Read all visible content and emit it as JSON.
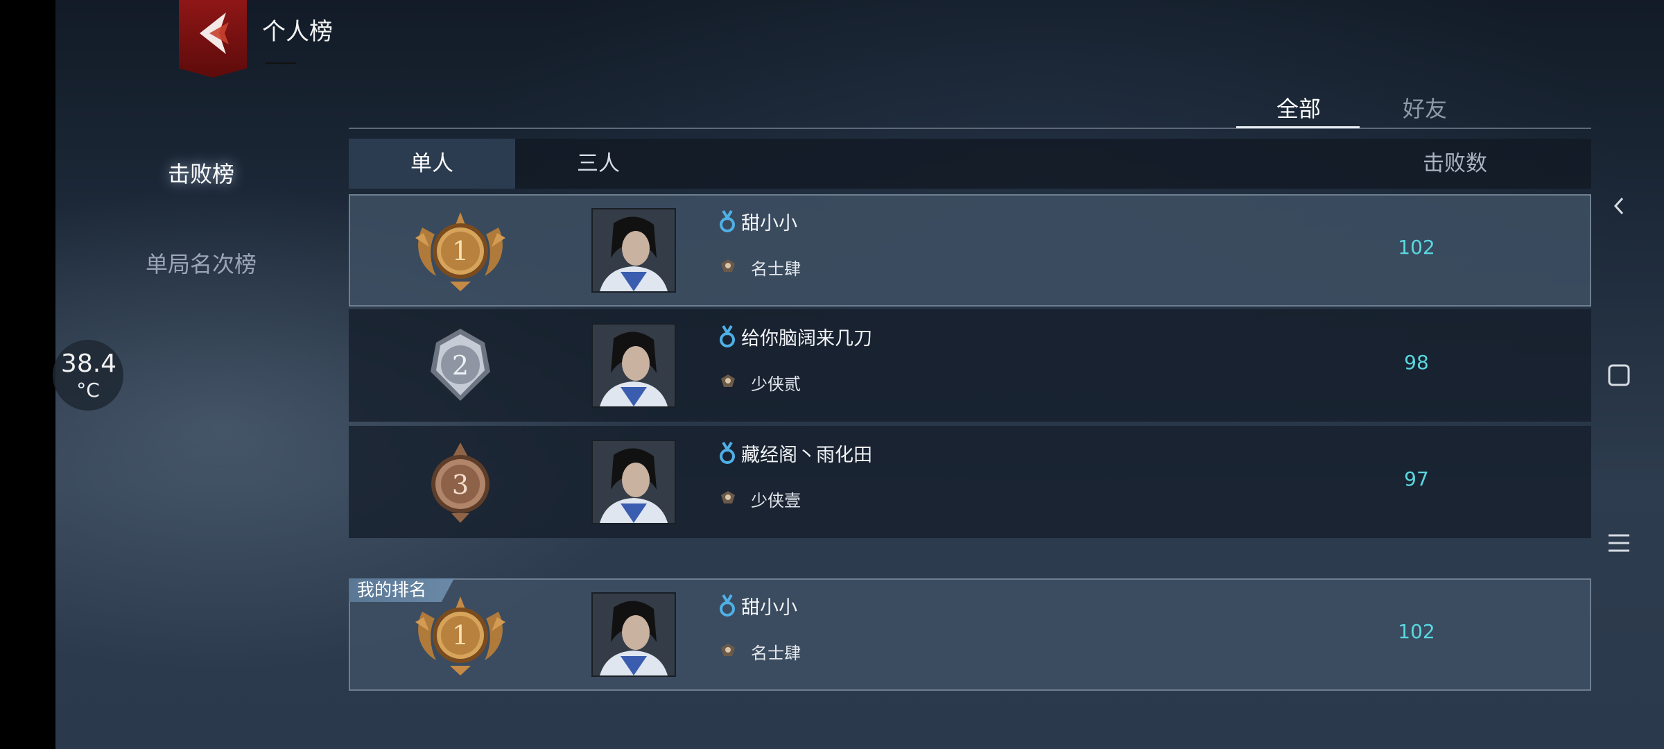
{
  "header": {
    "title": "个人榜"
  },
  "temperature": {
    "value": "38.4",
    "unit": "°C"
  },
  "sidebar": {
    "items": [
      {
        "label": "击败榜"
      },
      {
        "label": "单局名次榜"
      }
    ]
  },
  "filters": {
    "all": "全部",
    "friends": "好友"
  },
  "table": {
    "modes": {
      "single": "单人",
      "trio": "三人"
    },
    "col_kills": "击败数",
    "rows": [
      {
        "rank": "1",
        "name": "甜小小",
        "title": "名士肆",
        "kills": "102"
      },
      {
        "rank": "2",
        "name": "给你脑阔来几刀",
        "title": "少侠贰",
        "kills": "98"
      },
      {
        "rank": "3",
        "name": "藏经阁丶雨化田",
        "title": "少侠壹",
        "kills": "97"
      }
    ]
  },
  "my_rank": {
    "tag": "我的排名",
    "rank": "1",
    "name": "甜小小",
    "title": "名士肆",
    "kills": "102"
  },
  "colors": {
    "kills": "#5ad7e0",
    "gender": "#4fb0e6",
    "back_red": "#8f1616"
  },
  "icons": [
    "back-arrow-icon",
    "male-icon",
    "rank-badge-icon",
    "gold-medal-icon",
    "silver-medal-icon",
    "bronze-medal-icon",
    "nav-back-icon",
    "nav-home-icon",
    "nav-menu-icon"
  ]
}
